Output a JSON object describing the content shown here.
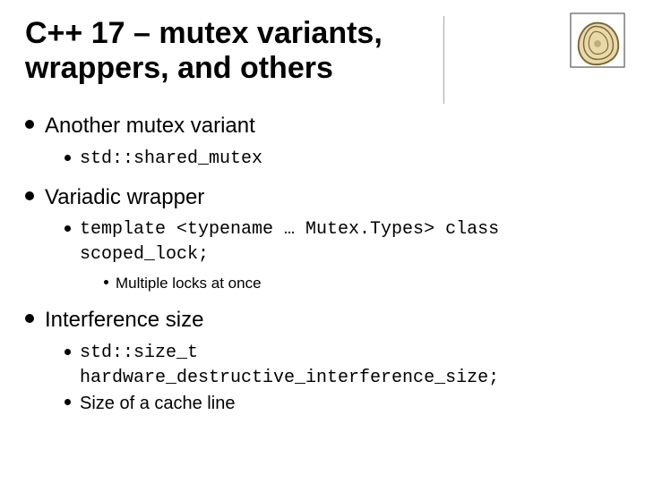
{
  "title": "C++ 17 – mutex variants, wrappers, and others",
  "bullets": {
    "b1": {
      "label": "Another mutex variant",
      "sub1": "std::shared_mutex"
    },
    "b2": {
      "label": "Variadic wrapper",
      "sub1": "template <typename … Mutex.Types> class scoped_lock;",
      "sub1_sub1": "Multiple locks at once"
    },
    "b3": {
      "label": "Interference size",
      "sub1": "std::size_t hardware_destructive_interference_size;",
      "sub2": "Size of a cache line"
    }
  }
}
